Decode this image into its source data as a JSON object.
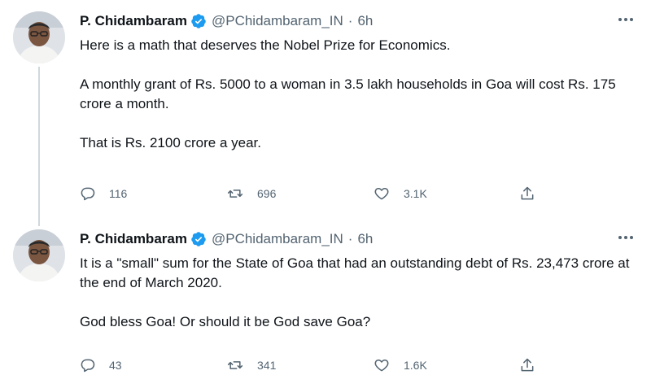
{
  "tweets": [
    {
      "author": {
        "name": "P. Chidambaram",
        "handle": "@PChidambaram_IN",
        "time": "6h"
      },
      "paragraphs": [
        "Here is a math that deserves the Nobel Prize for Economics.",
        "A monthly grant of Rs. 5000 to a woman in 3.5 lakh households in Goa will cost Rs. 175 crore a month.",
        "That is Rs. 2100 crore a year."
      ],
      "stats": {
        "replies": "116",
        "retweets": "696",
        "likes": "3.1K"
      }
    },
    {
      "author": {
        "name": "P. Chidambaram",
        "handle": "@PChidambaram_IN",
        "time": "6h"
      },
      "paragraphs": [
        "It is a \"small\" sum for the State of Goa that had an outstanding debt of Rs. 23,473 crore at the end of March 2020.",
        "God bless Goa! Or should it be God save Goa?"
      ],
      "stats": {
        "replies": "43",
        "retweets": "341",
        "likes": "1.6K"
      }
    }
  ],
  "separator": "·",
  "icons": {
    "verified": "verified-badge-icon",
    "more": "more-options-icon",
    "reply": "reply-icon",
    "retweet": "retweet-icon",
    "like": "heart-icon",
    "share": "share-icon"
  },
  "colors": {
    "text": "#0f1419",
    "secondary": "#536471",
    "verified": "#1d9bf0",
    "thread_line": "#cfd9de"
  }
}
